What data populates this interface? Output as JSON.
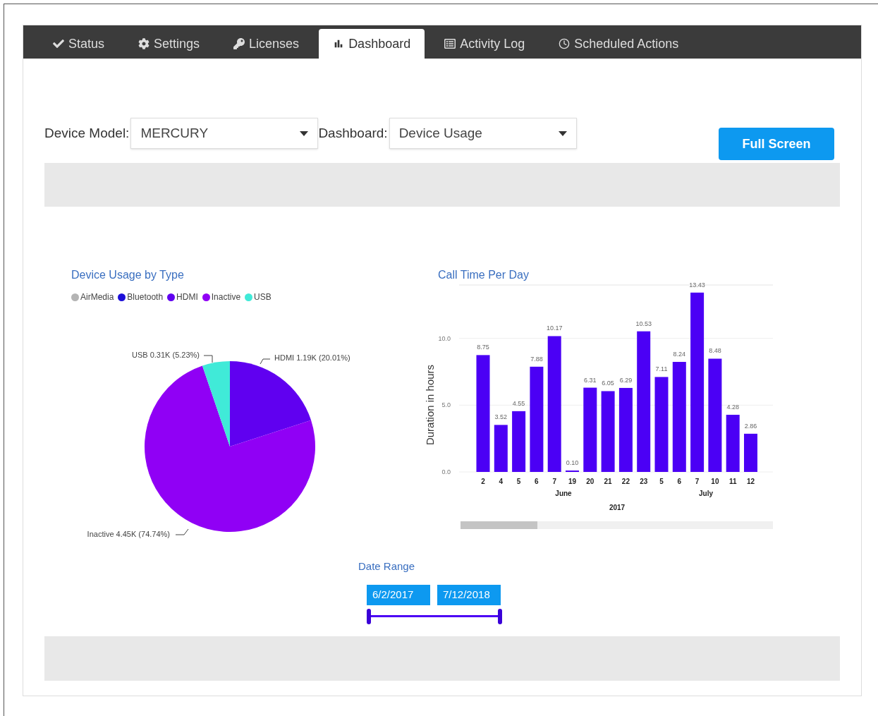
{
  "tabs": [
    {
      "label": "Status",
      "selected": false
    },
    {
      "label": "Settings",
      "selected": false
    },
    {
      "label": "Licenses",
      "selected": false
    },
    {
      "label": "Dashboard",
      "selected": true
    },
    {
      "label": "Activity Log",
      "selected": false
    },
    {
      "label": "Scheduled Actions",
      "selected": false
    }
  ],
  "filters": [
    {
      "label": "Device Model:",
      "value": "MERCURY"
    },
    {
      "label": "Dashboard:",
      "value": "Device Usage"
    }
  ],
  "full_screen_button": "Full Screen",
  "pie_panel": {
    "legend": [
      {
        "label": "AirMedia",
        "color": "#b4b4b4"
      },
      {
        "label": "Bluetooth",
        "color": "#1c0fd8"
      },
      {
        "label": "HDMI",
        "color": "#6000f0"
      },
      {
        "label": "Inactive",
        "color": "#9000f5"
      },
      {
        "label": "USB",
        "color": "#40ead8"
      }
    ],
    "chart_data": {
      "type": "pie",
      "title": "Device Usage by Type",
      "series": [
        {
          "values": [
            20.01,
            74.74,
            5.23
          ]
        }
      ],
      "value_labels": [
        "HDMI 1.19K (20.01%)",
        "Inactive 4.45K (74.74%)",
        "USB 0.31K (5.23%)"
      ]
    }
  },
  "bar_panel": {
    "month_labels": [
      "June",
      "July"
    ],
    "chart_data": {
      "type": "bar",
      "title": "Call Time Per Day",
      "ylabel": "Duration in hours",
      "xlabel": "2017",
      "categories": [
        "2",
        "4",
        "5",
        "6",
        "7",
        "19",
        "20",
        "21",
        "22",
        "23",
        "5",
        "6",
        "7",
        "10",
        "11",
        "12"
      ],
      "series": [
        {
          "color": "#4b00f5",
          "values": [
            8.75,
            3.52,
            4.55,
            7.88,
            10.17,
            0.1,
            6.31,
            6.05,
            6.29,
            10.53,
            7.11,
            8.24,
            13.43,
            8.48,
            4.28,
            2.86
          ]
        }
      ],
      "value_labels": [
        "8.75",
        "3.52",
        "4.55",
        "7.88",
        "10.17",
        "0.10",
        "6.31",
        "6.05",
        "6.29",
        "10.53",
        "7.11",
        "8.24",
        "13.43",
        "8.48",
        "4.28",
        "2.86"
      ],
      "ylim": [
        0,
        14
      ],
      "yticks": [
        {
          "value": 0,
          "label": "0.0"
        },
        {
          "value": 5,
          "label": "5.0"
        },
        {
          "value": 10,
          "label": "10.0"
        }
      ]
    }
  },
  "date_range": {
    "title": "Date Range",
    "start": "6/2/2017",
    "end": "7/12/2018",
    "level": 1
  }
}
